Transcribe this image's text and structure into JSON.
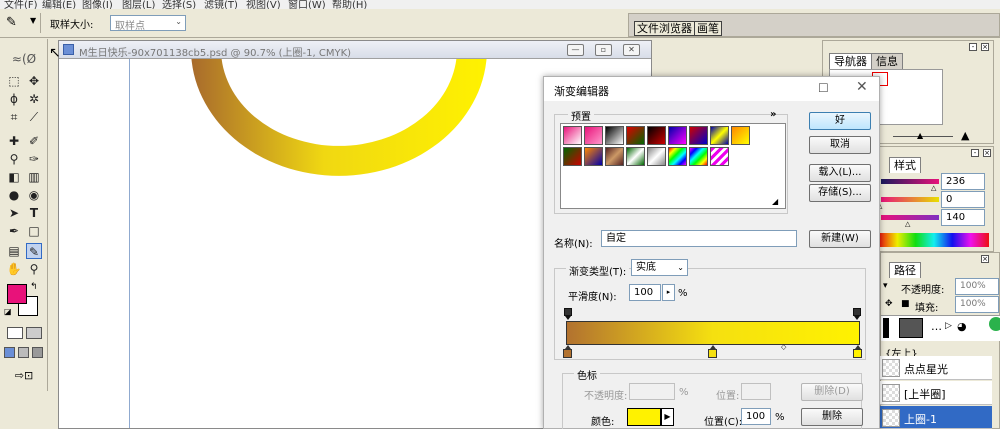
{
  "menu": [
    "文件(F)",
    "编辑(E)",
    "图像(I)",
    "图层(L)",
    "选择(S)",
    "滤镜(T)",
    "视图(V)",
    "窗口(W)",
    "帮助(H)"
  ],
  "options": {
    "sample_label": "取样大小:",
    "sample_value": "取样点",
    "tab_browser": "文件浏览器",
    "tab_brush": "画笔"
  },
  "document": {
    "title": "M生日快乐-90x701138cb5.psd @ 90.7% (上圈-1, CMYK)"
  },
  "navigator": {
    "tab_navigator": "导航器",
    "tab_info": "信息"
  },
  "color_panel": {
    "tab_styles": "样式",
    "c_value": "236",
    "m_value": "0",
    "y_value": "140"
  },
  "layers_panel": {
    "tab_paths": "路径",
    "opacity_label": "不透明度:",
    "opacity_value": "100%",
    "fill_label": "填充:",
    "fill_value": "100%",
    "group_label": "{左上}",
    "layers": [
      {
        "name": "点点星光"
      },
      {
        "name": "[上半圈]"
      },
      {
        "name": "上圈-1"
      }
    ]
  },
  "dialog": {
    "title": "渐变编辑器",
    "presets_label": "预置",
    "presets_arrow": "»",
    "ok_label": "好",
    "cancel_label": "取消",
    "load_label": "载入(L)...",
    "save_label": "存储(S)...",
    "name_label": "名称(N):",
    "name_value": "自定",
    "new_label": "新建(W)",
    "type_label": "渐变类型(T):",
    "type_value": "实底",
    "smooth_label": "平滑度(N):",
    "smooth_value": "100",
    "smooth_unit": "%",
    "stops_group": "色标",
    "opacity_label": "不透明度:",
    "opacity_unit": "%",
    "location_label": "位置:",
    "delete_label": "删除(D)",
    "color_label": "颜色:",
    "location_c_label": "位置(C):",
    "location_c_value": "100",
    "location_c_unit": "%",
    "delete2_label": "删除"
  },
  "colors": {
    "foreground": "#e8127a",
    "gradient_start": "#b2722f",
    "gradient_mid": "#f5e010",
    "gradient_end": "#fff200",
    "accent_blue": "#316ac5"
  }
}
